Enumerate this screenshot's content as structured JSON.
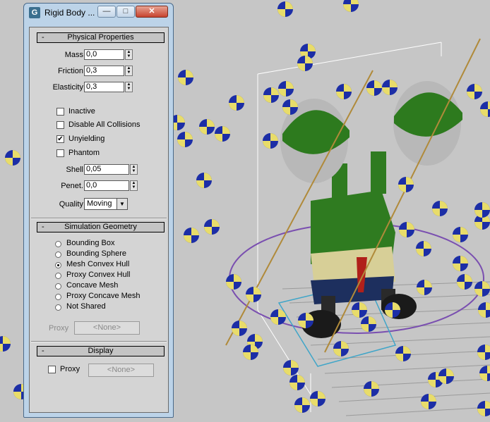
{
  "window": {
    "title": "Rigid Body ...",
    "minimize_label": "—",
    "maximize_label": "□",
    "close_label": "✕"
  },
  "physical_properties": {
    "header": "Physical Properties",
    "collapse": "-",
    "mass": {
      "label": "Mass",
      "value": "0,0"
    },
    "friction": {
      "label": "Friction",
      "value": "0,3"
    },
    "elasticity": {
      "label": "Elasticity",
      "value": "0,3"
    },
    "checkboxes": [
      {
        "label": "Inactive",
        "checked": false
      },
      {
        "label": "Disable All Collisions",
        "checked": false
      },
      {
        "label": "Unyielding",
        "checked": true
      },
      {
        "label": "Phantom",
        "checked": false
      }
    ],
    "shell": {
      "label": "Shell",
      "value": "0,05"
    },
    "penet": {
      "label": "Penet.",
      "value": "0,0"
    },
    "quality": {
      "label": "Quality",
      "value": "Moving"
    }
  },
  "simulation_geometry": {
    "header": "Simulation Geometry",
    "collapse": "-",
    "options": [
      {
        "label": "Bounding Box",
        "selected": false
      },
      {
        "label": "Bounding Sphere",
        "selected": false
      },
      {
        "label": "Mesh Convex Hull",
        "selected": true
      },
      {
        "label": "Proxy Convex Hull",
        "selected": false
      },
      {
        "label": "Concave Mesh",
        "selected": false
      },
      {
        "label": "Proxy Concave Mesh",
        "selected": false
      },
      {
        "label": "Not Shared",
        "selected": false
      }
    ],
    "proxy_label": "Proxy",
    "proxy_button": "<None>"
  },
  "display": {
    "header": "Display",
    "collapse": "-",
    "proxy_label": "Proxy",
    "proxy_checked": false,
    "proxy_button": "<None>"
  },
  "colors": {
    "viewport_bg": "#c6c6c6",
    "ball_blue": "#1c2ea6",
    "ball_yellow": "#e8dc6a",
    "character_green": "#2d7a1e",
    "panel_frame": "#bcd3e8"
  }
}
